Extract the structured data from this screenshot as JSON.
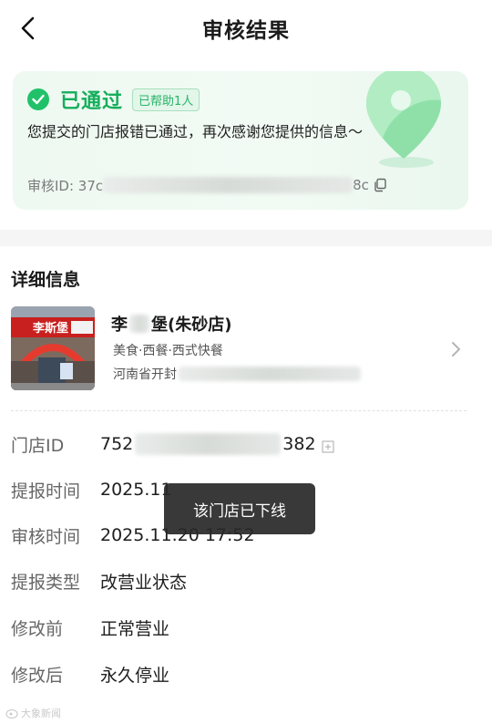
{
  "header": {
    "title": "审核结果"
  },
  "result": {
    "status": "已通过",
    "badge": "已帮助1人",
    "description": "您提交的门店报错已通过，再次感谢您提供的信息～",
    "audit_id_prefix": "审核ID: 37c",
    "audit_id_suffix": "8c"
  },
  "details": {
    "title": "详细信息",
    "store": {
      "name_prefix": "李",
      "name_suffix": "堡(朱砂店)",
      "category": "美食·西餐·西式快餐",
      "address_prefix": "河南省开封",
      "sign_text": "李斯堡"
    },
    "rows": [
      {
        "label": "门店ID",
        "value_prefix": "752",
        "value_suffix": "382"
      },
      {
        "label": "提报时间",
        "value": "2025.11"
      },
      {
        "label": "审核时间",
        "value": "2025.11.20 17:52"
      },
      {
        "label": "提报类型",
        "value": "改营业状态"
      },
      {
        "label": "修改前",
        "value": "正常营业"
      },
      {
        "label": "修改后",
        "value": "永久停业"
      }
    ]
  },
  "toast": "该门店已下线",
  "watermark": "大象新闻",
  "colors": {
    "accent": "#15ae5c",
    "card_bg": "#eef9f1"
  }
}
